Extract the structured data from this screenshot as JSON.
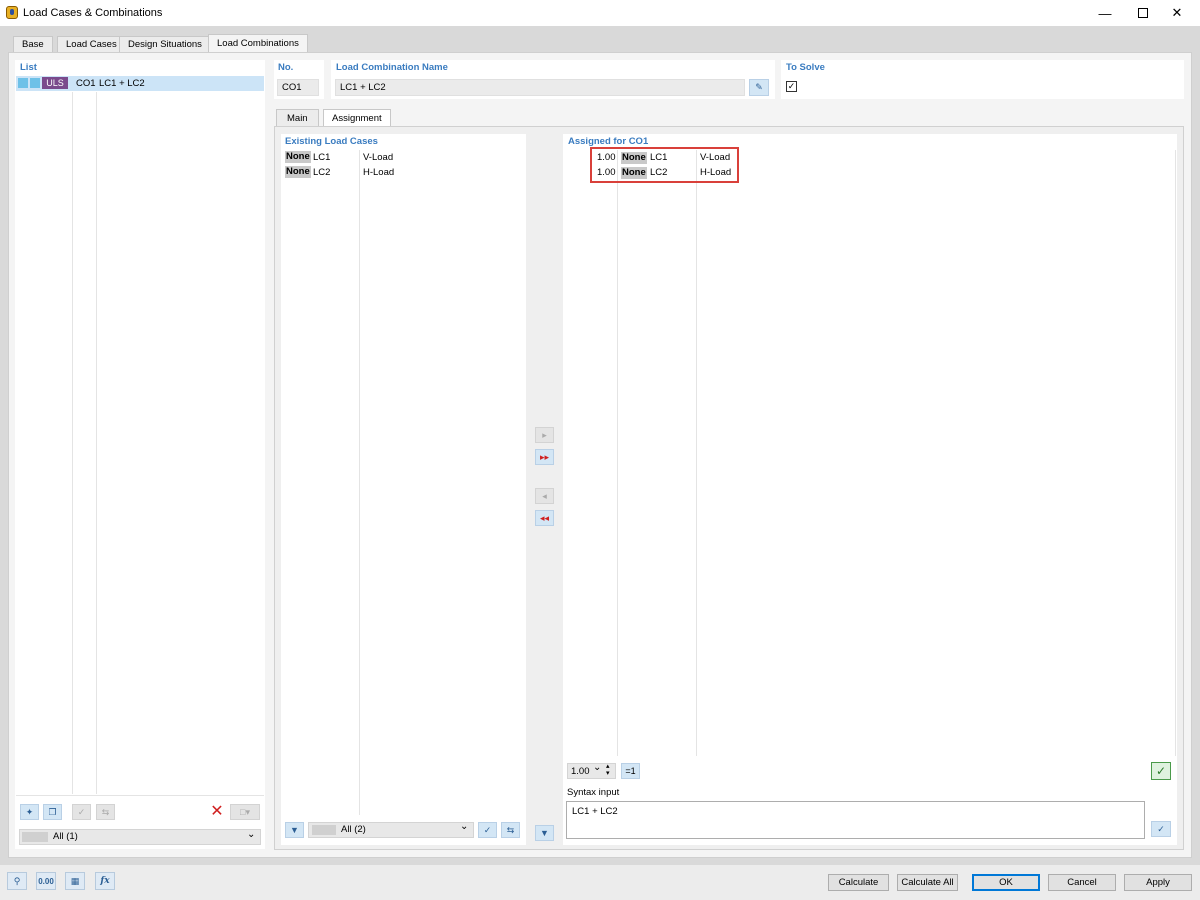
{
  "window": {
    "title": "Load Cases & Combinations"
  },
  "tabs": [
    "Base",
    "Load Cases",
    "Design Situations",
    "Load Combinations"
  ],
  "list": {
    "header": "List",
    "items": [
      {
        "badge": "ULS",
        "no": "CO1",
        "name": "LC1 + LC2"
      }
    ],
    "filter_value": "All (1)"
  },
  "no": {
    "label": "No.",
    "value": "CO1"
  },
  "lc_name": {
    "label": "Load Combination Name",
    "value": "LC1 + LC2"
  },
  "to_solve": {
    "label": "To Solve",
    "checked": true
  },
  "subtabs": [
    "Main",
    "Assignment"
  ],
  "existing": {
    "header": "Existing Load Cases",
    "rows": [
      {
        "tag": "None",
        "lc": "LC1",
        "name": "V-Load"
      },
      {
        "tag": "None",
        "lc": "LC2",
        "name": "H-Load"
      }
    ],
    "filter_value": "All (2)"
  },
  "assigned": {
    "header": "Assigned for CO1",
    "rows": [
      {
        "factor": "1.00",
        "tag": "None",
        "lc": "LC1",
        "name": "V-Load"
      },
      {
        "factor": "1.00",
        "tag": "None",
        "lc": "LC2",
        "name": "H-Load"
      }
    ],
    "factor_value": "1.00",
    "eq1_label": "=1",
    "highlight_color": "#d9403a"
  },
  "syntax": {
    "label": "Syntax input",
    "value": "LC1 + LC2"
  },
  "buttons": {
    "calculate": "Calculate",
    "calculate_all": "Calculate All",
    "ok": "OK",
    "cancel": "Cancel",
    "apply": "Apply"
  },
  "bottom_icons": [
    "search-icon",
    "0.00",
    "model-icon",
    "fx-icon"
  ],
  "colors": {
    "accent": "#3a7cc0",
    "uls_badge": "#7a4a8c",
    "list_selection": "#cce4f7"
  }
}
